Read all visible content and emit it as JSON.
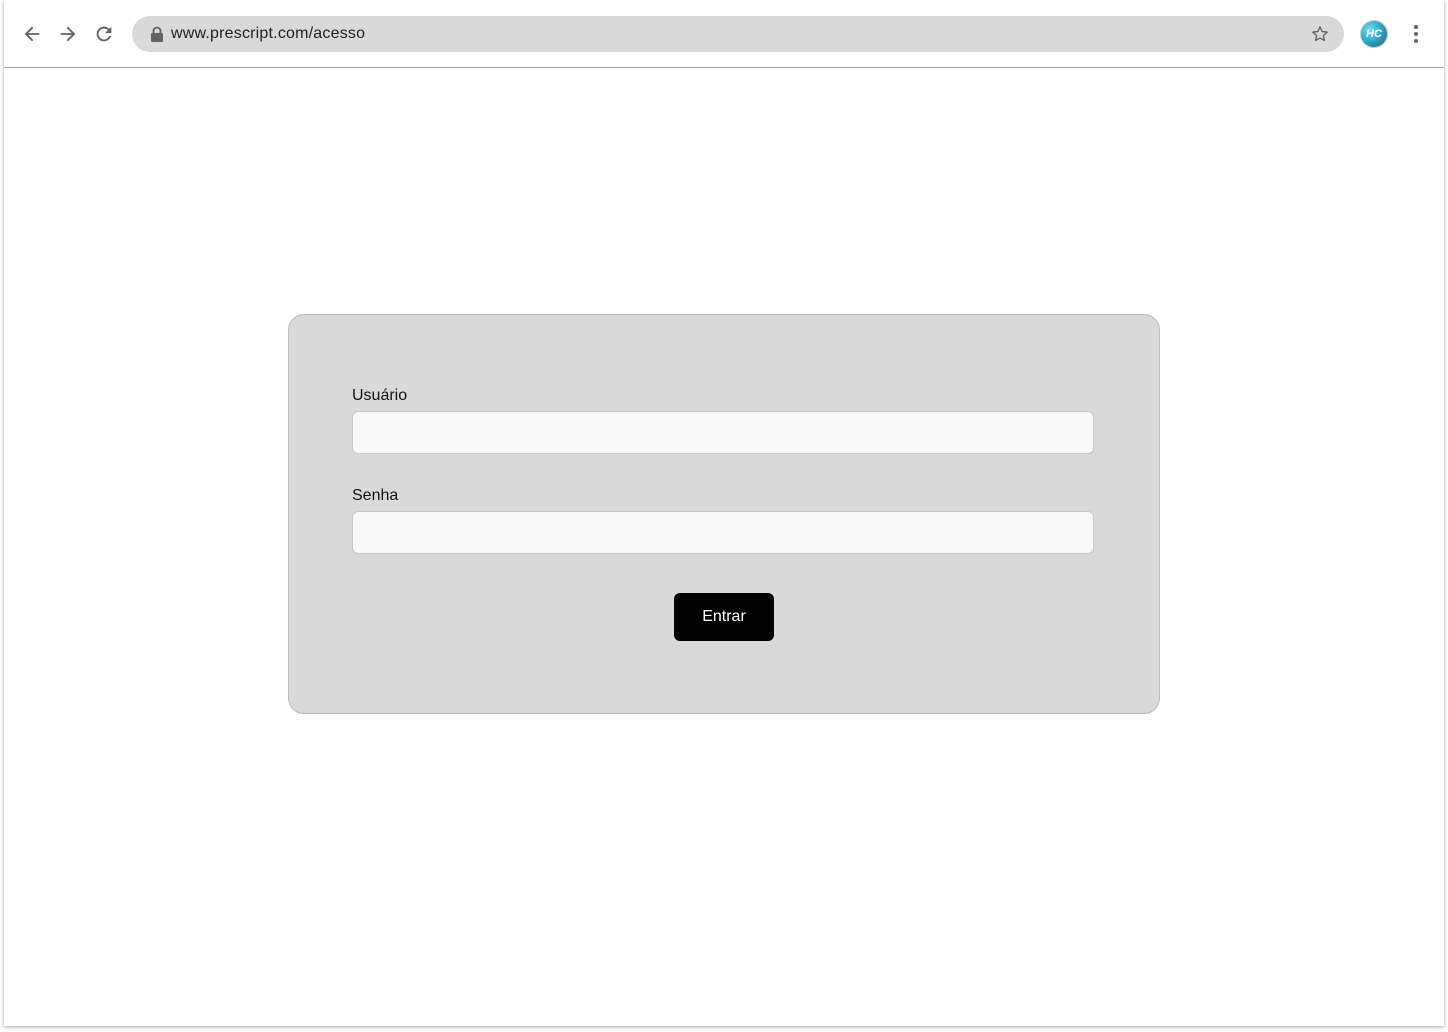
{
  "browser": {
    "url": "www.prescript.com/acesso",
    "avatar_initials": "HC",
    "icons": {
      "back": "back-arrow-icon",
      "forward": "forward-arrow-icon",
      "reload": "reload-icon",
      "lock": "lock-icon",
      "bookmark": "star-icon",
      "menu": "more-vertical-icon"
    }
  },
  "login_form": {
    "username_label": "Usuário",
    "username_value": "",
    "password_label": "Senha",
    "password_value": "",
    "submit_label": "Entrar"
  },
  "colors": {
    "card_background": "#d9d9d9",
    "button_background": "#000000",
    "button_text": "#ffffff",
    "input_background": "#f8f8f8"
  }
}
